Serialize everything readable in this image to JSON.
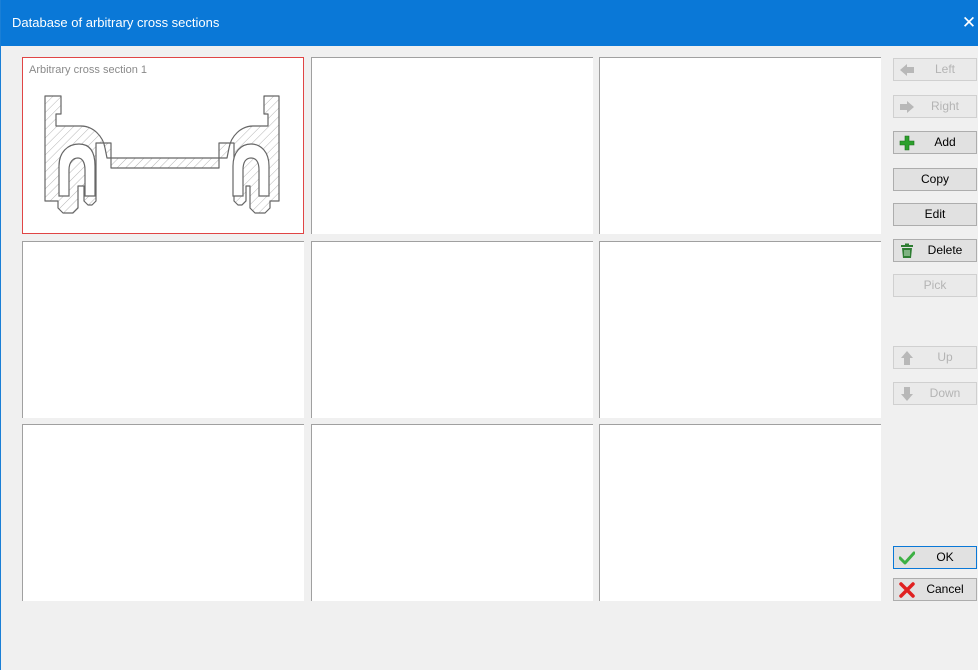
{
  "window": {
    "title": "Database of arbitrary cross sections",
    "close_glyph": "✕"
  },
  "grid": {
    "cells": [
      {
        "label": "Arbitrary cross section 1"
      },
      {
        "label": ""
      },
      {
        "label": ""
      },
      {
        "label": ""
      },
      {
        "label": ""
      },
      {
        "label": ""
      },
      {
        "label": ""
      },
      {
        "label": ""
      },
      {
        "label": ""
      }
    ]
  },
  "buttons": {
    "left": "Left",
    "right": "Right",
    "add": "Add",
    "copy": "Copy",
    "edit": "Edit",
    "delete": "Delete",
    "pick": "Pick",
    "up": "Up",
    "down": "Down",
    "ok": "OK",
    "cancel": "Cancel"
  },
  "colors": {
    "titlebar": "#0a78d7",
    "selection_border": "#e04545",
    "add_icon": "#2ca02c",
    "delete_icon": "#2e7d32",
    "ok_icon": "#3cb043",
    "cancel_icon": "#e02020",
    "disabled_icon": "#b8b8b8"
  }
}
